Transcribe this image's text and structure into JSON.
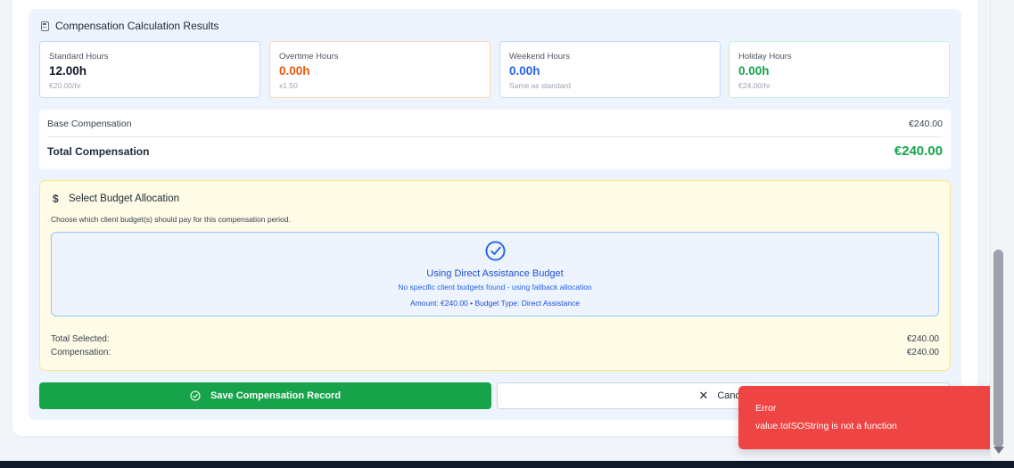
{
  "results": {
    "header": "Compensation Calculation Results",
    "cards": [
      {
        "label": "Standard Hours",
        "value": "12.00h",
        "sub": "€20.00/hr",
        "color": "#111827",
        "border": "#bfdbfe"
      },
      {
        "label": "Overtime Hours",
        "value": "0.00h",
        "sub": "x1.50",
        "color": "#ea580c",
        "border": "#fed7aa"
      },
      {
        "label": "Weekend Hours",
        "value": "0.00h",
        "sub": "Same as standard",
        "color": "#2563eb",
        "border": "#bfdbfe"
      },
      {
        "label": "Holiday Hours",
        "value": "0.00h",
        "sub": "€24.00/hr",
        "color": "#16a34a",
        "border": "#bbf7d0"
      }
    ],
    "base_label": "Base Compensation",
    "base_value": "€240.00",
    "total_label": "Total Compensation",
    "total_value": "€240.00"
  },
  "budget": {
    "title": "Select Budget Allocation",
    "icon": "dollar-icon",
    "description": "Choose which client budget(s) should pay for this compensation period.",
    "direct": {
      "icon": "check-circle-icon",
      "title": "Using Direct Assistance Budget",
      "subtitle": "No specific client budgets found - using fallback allocation",
      "meta": "Amount: €240.00  •  Budget Type: Direct Assistance"
    },
    "total_selected_label": "Total Selected:",
    "total_selected_value": "€240.00",
    "compensation_label": "Compensation:",
    "compensation_value": "€240.00"
  },
  "actions": {
    "save_label": "Save Compensation Record",
    "cancel_label": "Cancel"
  },
  "toast": {
    "title": "Error",
    "message": "value.toISOString is not a function",
    "color": "#ef4444"
  }
}
